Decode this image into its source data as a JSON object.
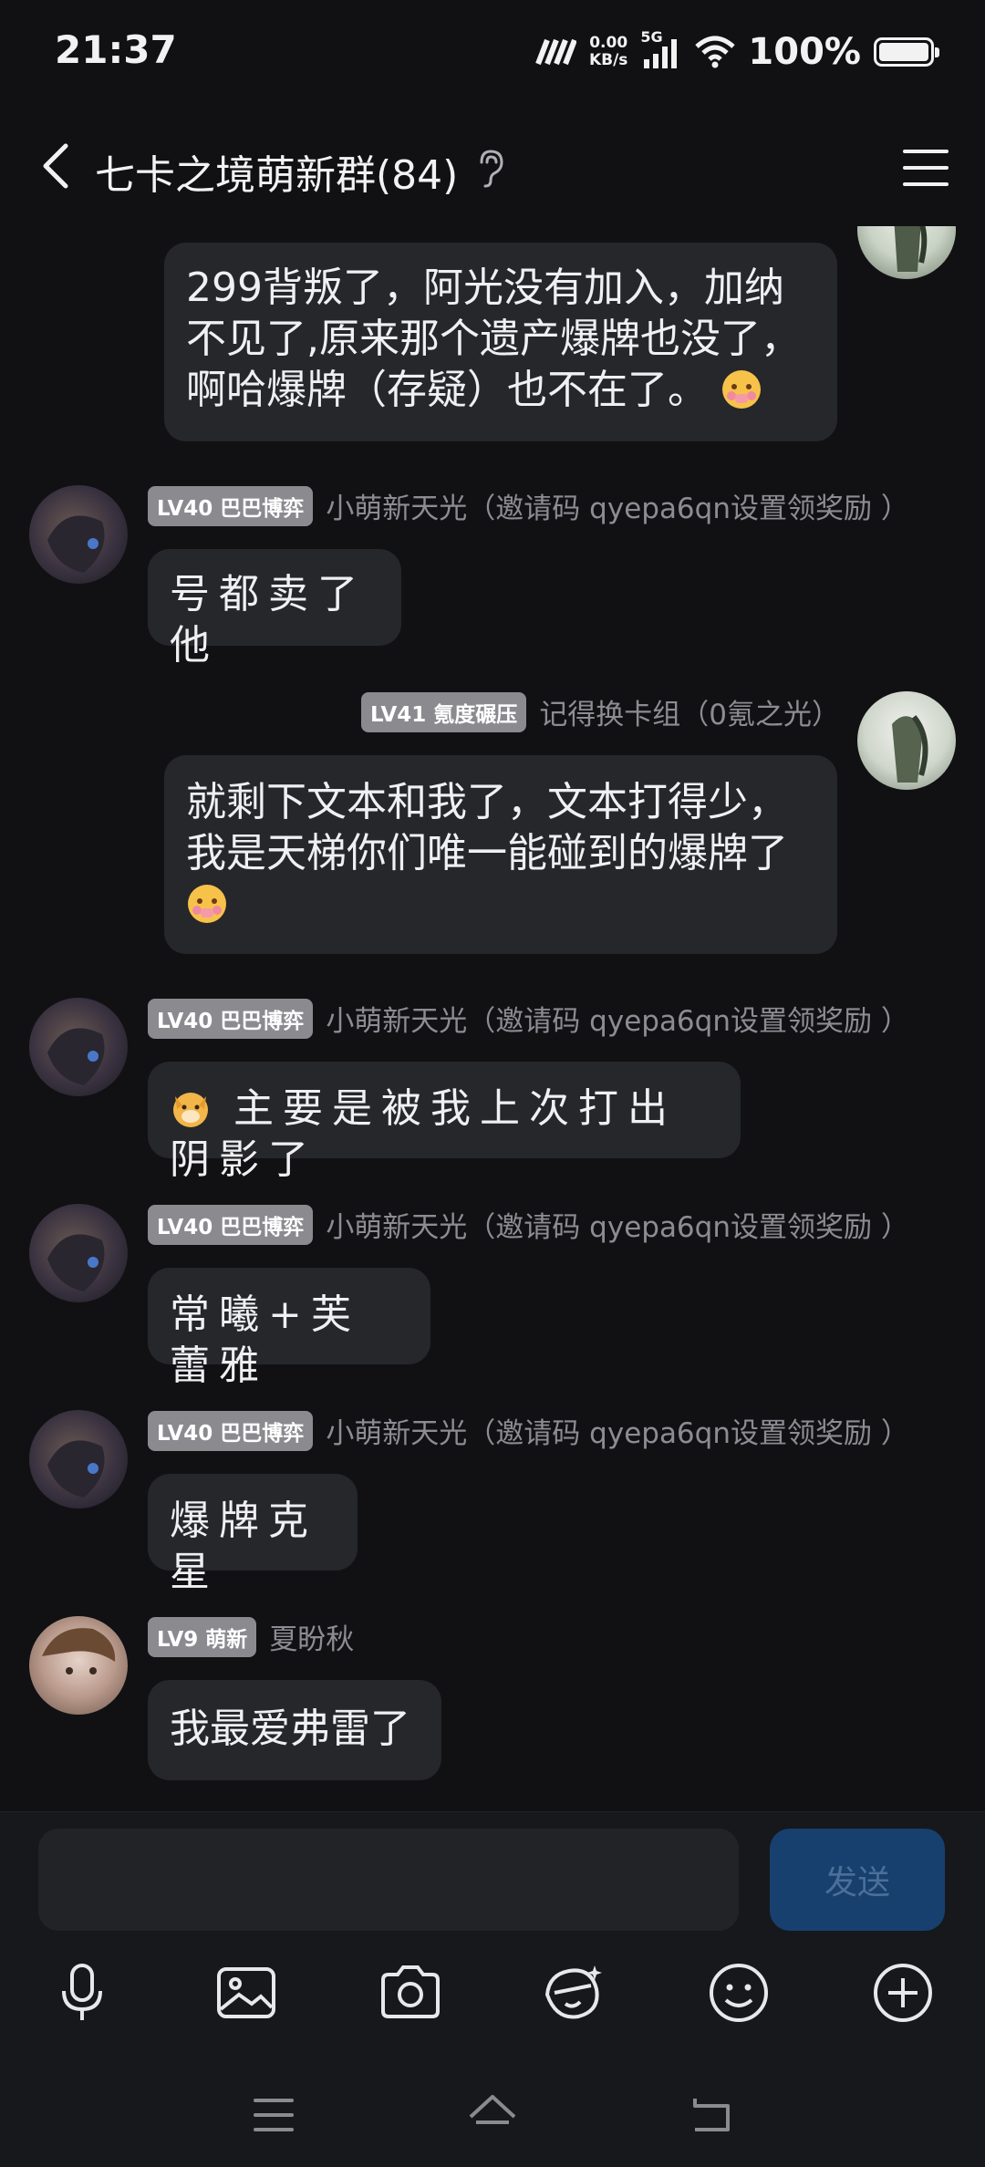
{
  "status_bar": {
    "time": "21:37",
    "net_speed_value": "0.00",
    "net_speed_unit": "KB/s",
    "network": "5G",
    "battery": "100%"
  },
  "header": {
    "title": "七卡之境萌新群(84)"
  },
  "messages": [
    {
      "side": "right",
      "text": "299背叛了，阿光没有加入，加纳不见了,原来那个遗产爆牌也没了，啊哈爆牌（存疑）也不在了。"
    },
    {
      "side": "left",
      "level": "LV40 巴巴博弈",
      "nick": "小萌新天光（邀请码 qyepa6qn设置领奖励 ）",
      "text": "号都卖了他"
    },
    {
      "side": "right",
      "level": "LV41 氪度碾压",
      "nick": "记得换卡组（0氪之光）",
      "text": "就剩下文本和我了，文本打得少，我是天梯你们唯一能碰到的爆牌了"
    },
    {
      "side": "left",
      "level": "LV40 巴巴博弈",
      "nick": "小萌新天光（邀请码 qyepa6qn设置领奖励 ）",
      "text": "主要是被我上次打出阴影了"
    },
    {
      "side": "left",
      "level": "LV40 巴巴博弈",
      "nick": "小萌新天光（邀请码 qyepa6qn设置领奖励 ）",
      "text": "常曦+芙蕾雅"
    },
    {
      "side": "left",
      "level": "LV40 巴巴博弈",
      "nick": "小萌新天光（邀请码 qyepa6qn设置领奖励 ）",
      "text": "爆牌克星"
    },
    {
      "side": "left",
      "level": "LV9 萌新",
      "nick": "夏盼秋",
      "text": "我最爱弗雷了"
    }
  ],
  "input": {
    "value": "",
    "send_label": "发送"
  },
  "colors": {
    "background": "#111114",
    "bubble": "#26272b",
    "send_button": "#17406e",
    "level_badge": "#8a8a8f"
  }
}
